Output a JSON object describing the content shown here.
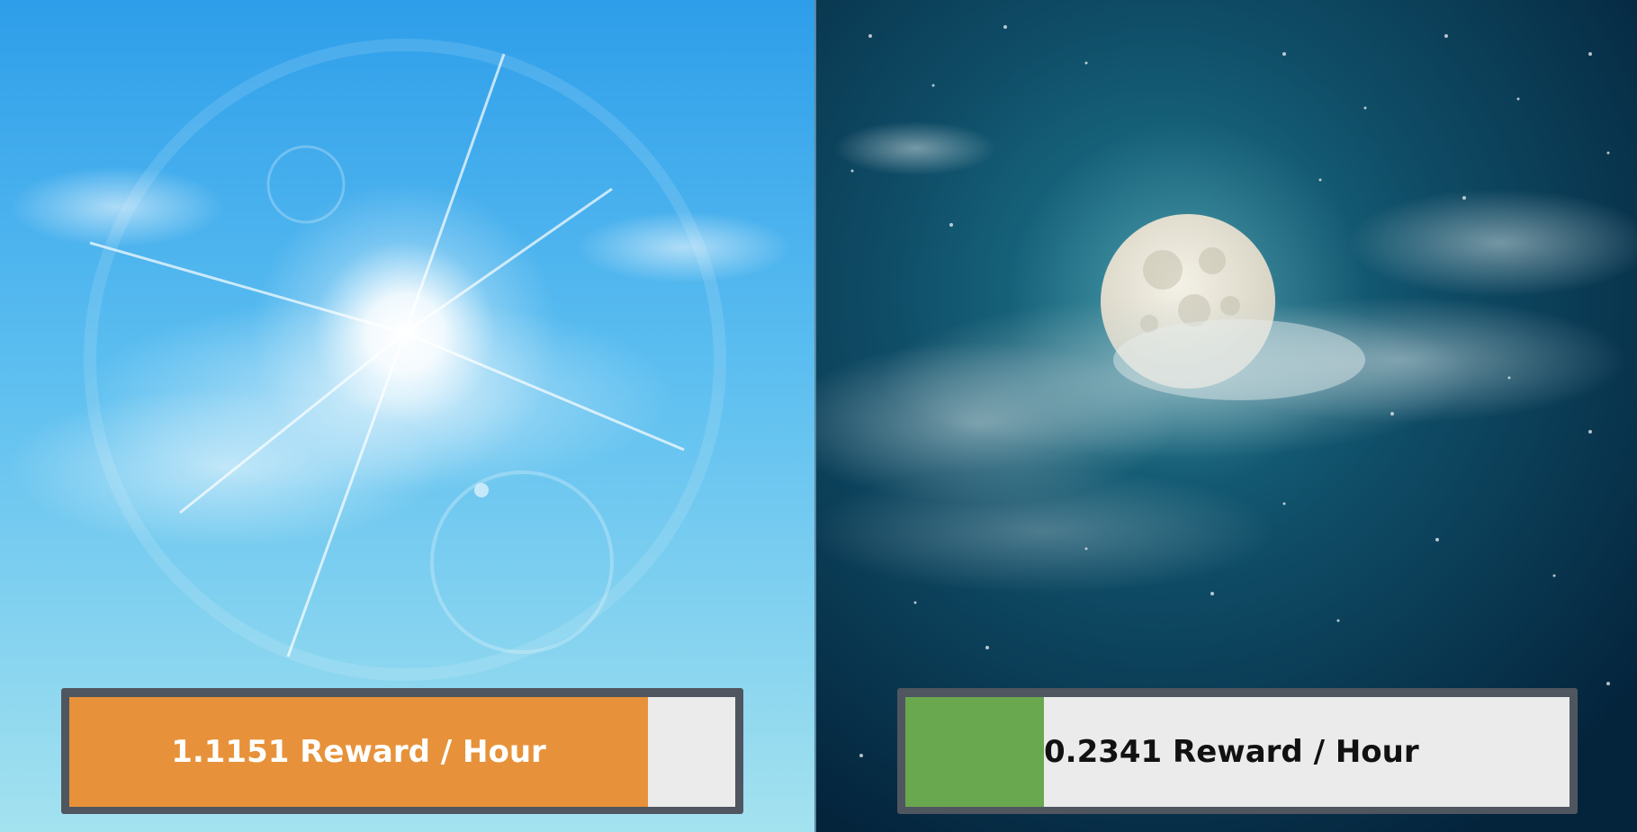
{
  "day": {
    "rate_label": "1.1151 Reward / Hour",
    "fill_fraction": 0.869,
    "fill_color": "#e7923a",
    "sky_top": "#2ea0e8",
    "sky_bottom": "#9fe0f0"
  },
  "night": {
    "rate_label": "0.2341 Reward / Hour",
    "fill_fraction": 0.209,
    "fill_color": "#6aa84f",
    "sky_center": "#1a6a80",
    "sky_edge": "#052a44"
  }
}
